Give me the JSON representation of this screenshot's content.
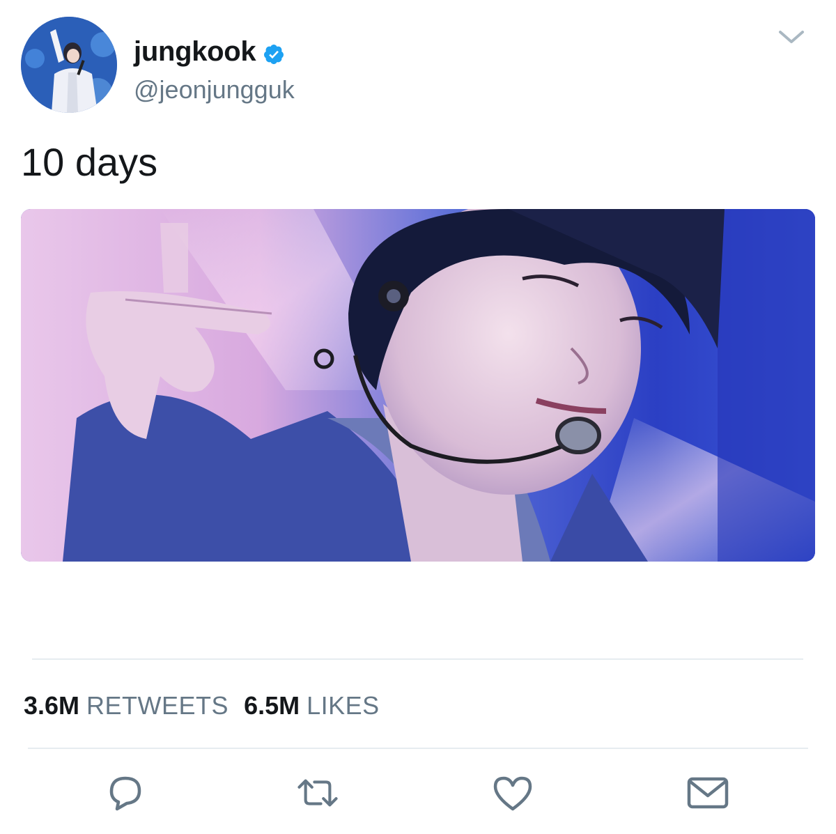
{
  "tweet": {
    "display_name": "jungkook",
    "handle": "@jeonjungguk",
    "text": "10 days",
    "verified_icon": "verified-badge-icon",
    "menu_icon": "chevron-down-icon"
  },
  "stats": {
    "retweets_count": "3.6M",
    "retweets_label": "RETWEETS",
    "likes_count": "6.5M",
    "likes_label": "LIKES"
  },
  "actions": {
    "reply_icon": "reply-icon",
    "retweet_icon": "retweet-icon",
    "like_icon": "heart-icon",
    "dm_icon": "envelope-icon"
  },
  "colors": {
    "text_primary": "#14171a",
    "text_secondary": "#657786",
    "verified_blue": "#1da1f2",
    "divider": "#e6ecf0",
    "icon_gray": "#657786"
  }
}
